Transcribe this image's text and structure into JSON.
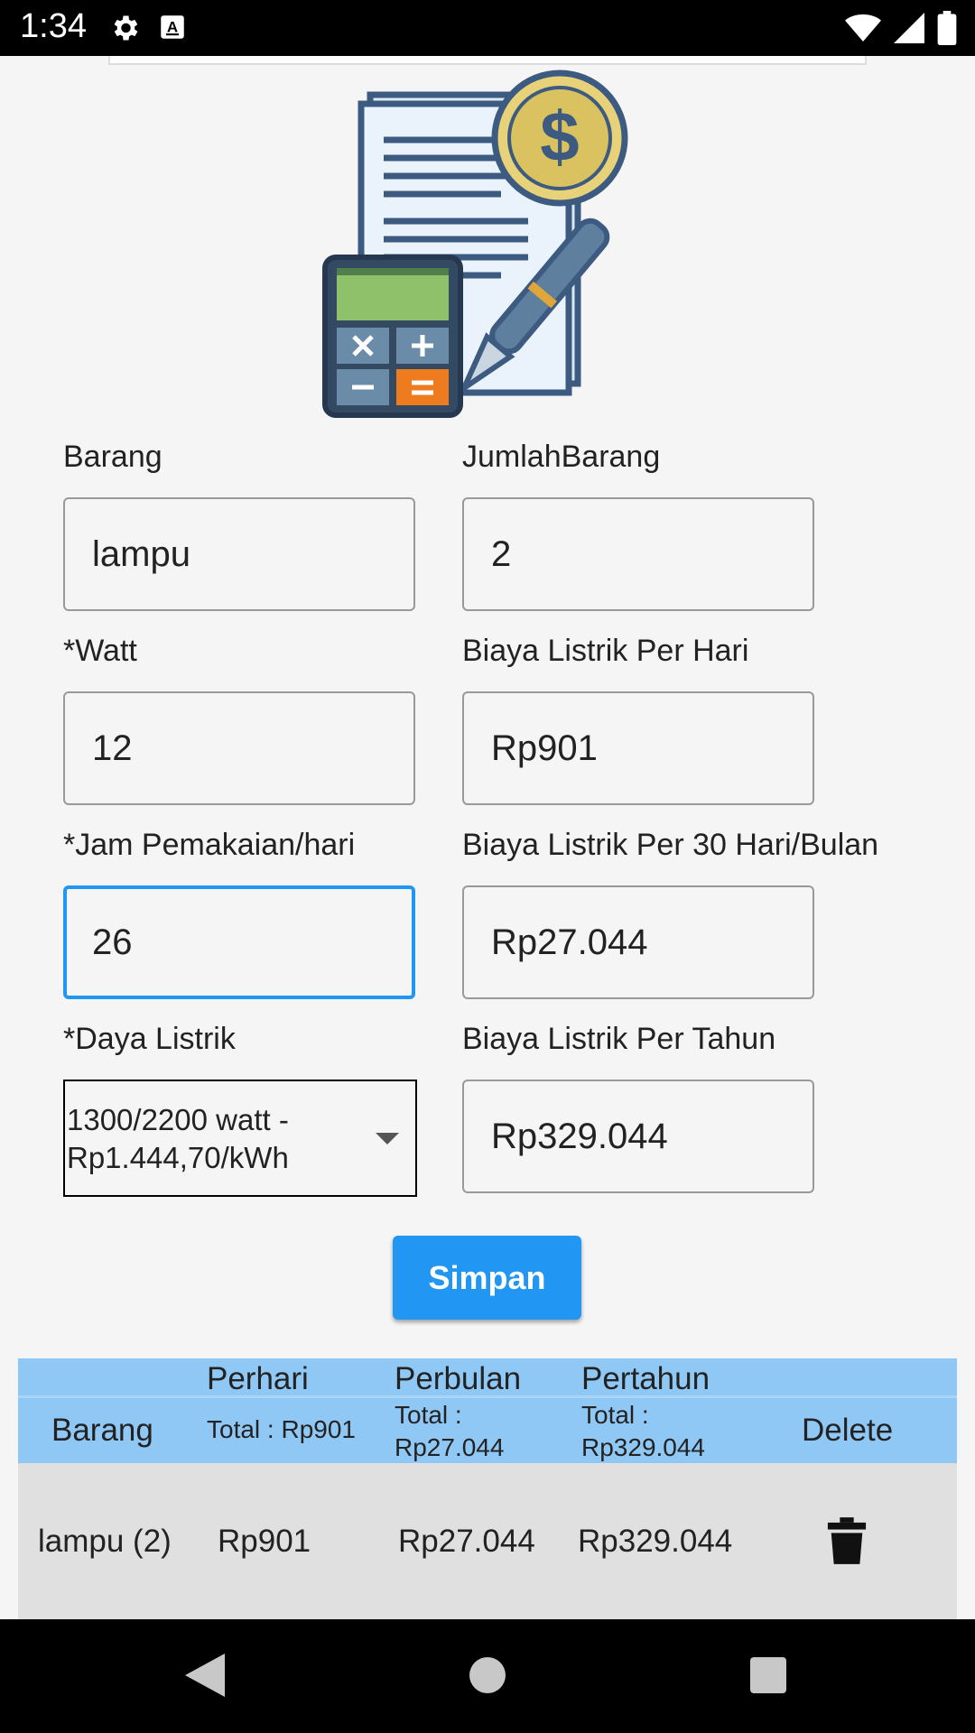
{
  "status_bar": {
    "time": "1:34",
    "left_icons": [
      "gear-icon",
      "a-keyboard-icon"
    ],
    "right_icons": [
      "wifi-icon",
      "signal-icon",
      "battery-icon"
    ]
  },
  "illustration": {
    "name": "bill-calculator-illustration"
  },
  "form": {
    "barang": {
      "label": "Barang",
      "value": "lampu"
    },
    "jumlah_barang": {
      "label": "JumlahBarang",
      "value": "2"
    },
    "watt": {
      "label": "*Watt",
      "value": "12"
    },
    "biaya_per_hari": {
      "label": "Biaya Listrik Per Hari",
      "value": "Rp901"
    },
    "jam_pemakaian": {
      "label": "*Jam Pemakaian/hari",
      "value": "26"
    },
    "biaya_per_bulan": {
      "label": "Biaya Listrik Per 30 Hari/Bulan",
      "value": "Rp27.044"
    },
    "daya_listrik": {
      "label": "*Daya Listrik",
      "selected": "1300/2200 watt - Rp1.444,70/kWh"
    },
    "biaya_per_tahun": {
      "label": "Biaya Listrik Per Tahun",
      "value": "Rp329.044"
    }
  },
  "save_button": "Simpan",
  "table": {
    "headers": {
      "barang": "Barang",
      "perhari": "Perhari",
      "perhari_total": "Total : Rp901",
      "perbulan": "Perbulan",
      "perbulan_total": "Total : Rp27.044",
      "pertahun": "Pertahun",
      "pertahun_total": "Total : Rp329.044",
      "delete": "Delete"
    },
    "rows": [
      {
        "barang": "lampu (2)",
        "perhari": "Rp901",
        "perbulan": "Rp27.044",
        "pertahun": "Rp329.044",
        "delete_icon": "trash-icon"
      }
    ]
  },
  "nav_bar": [
    "back-icon",
    "home-icon",
    "recents-icon"
  ],
  "colors": {
    "accent": "#2196f3",
    "table_header": "#90c8f5",
    "table_row": "#e0e0e0"
  }
}
